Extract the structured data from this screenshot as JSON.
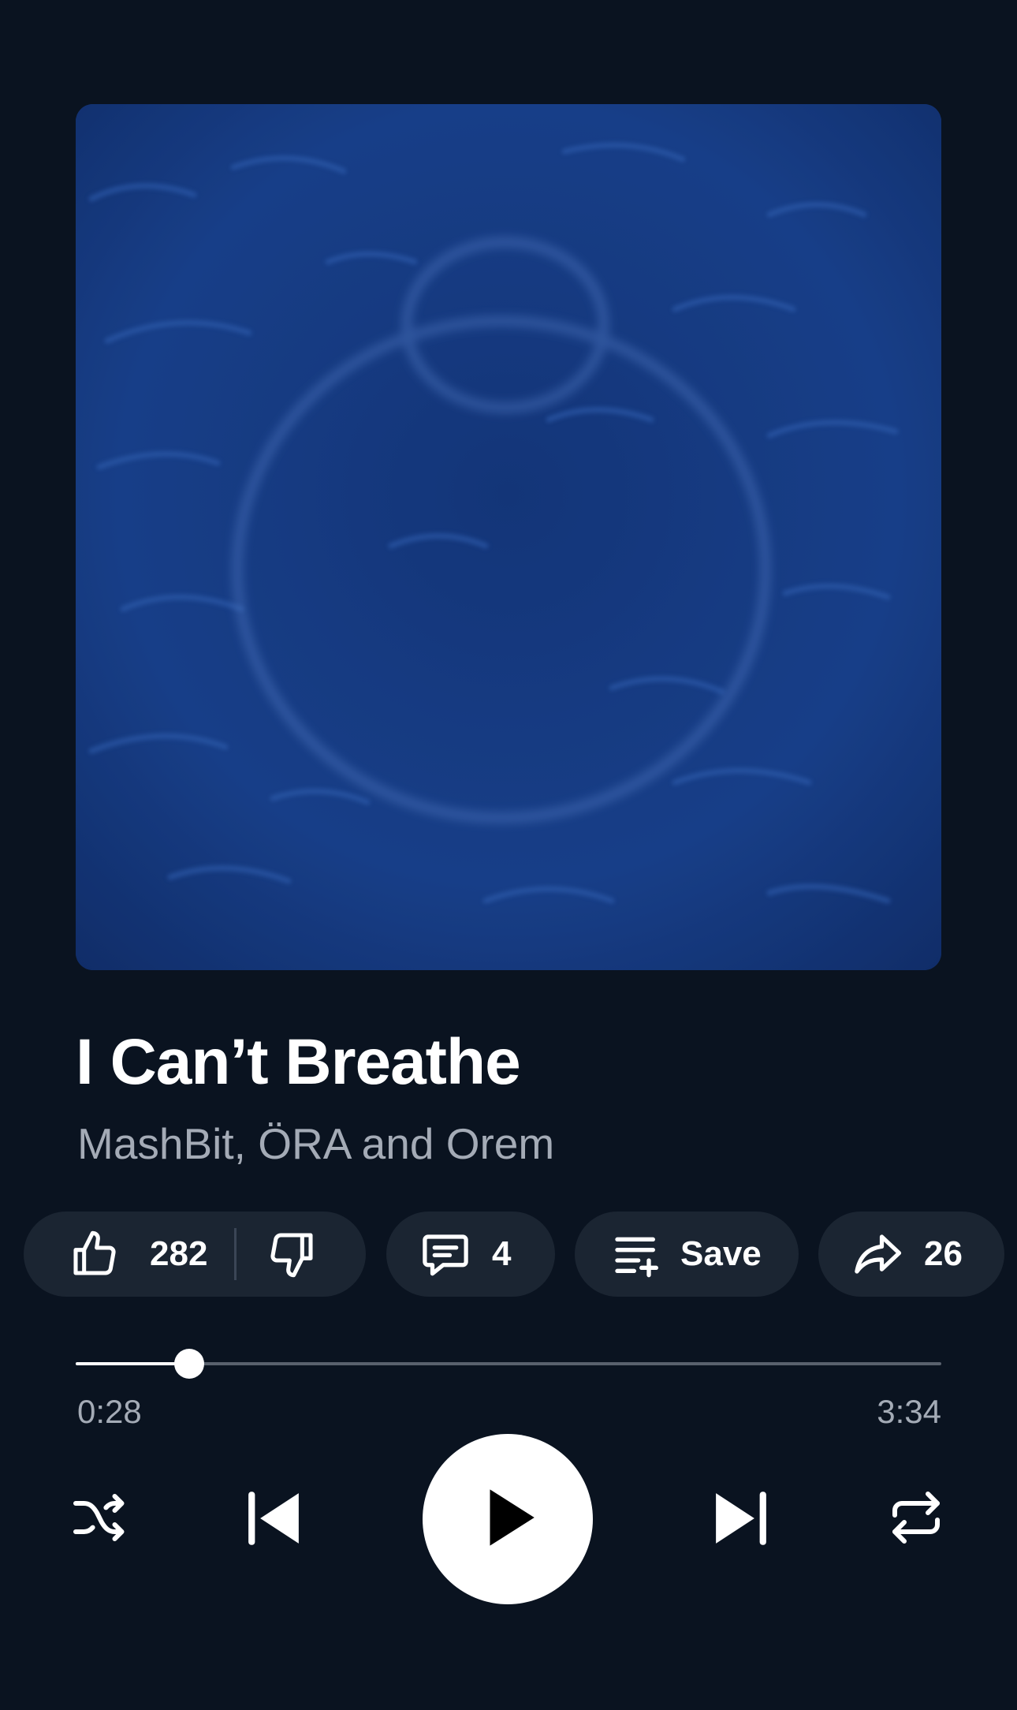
{
  "track": {
    "title": "I Can’t Breathe",
    "artists": "MashBit, ÖRA and Orem",
    "artwork_icon": "album-artwork"
  },
  "actions": {
    "like_count": "282",
    "comment_count": "4",
    "save_label": "Save",
    "share_count": "26",
    "icons": [
      "thumbs-up-icon",
      "thumbs-down-icon",
      "comment-icon",
      "playlist-add-icon",
      "share-icon"
    ]
  },
  "progress": {
    "current_time": "0:28",
    "total_time": "3:34",
    "played_fraction": 0.131
  },
  "controls": {
    "icons": [
      "shuffle-icon",
      "previous-icon",
      "play-icon",
      "next-icon",
      "repeat-icon"
    ]
  },
  "colors": {
    "background": "#0a1320",
    "pill": "#1b2532",
    "secondary_text": "#a4abb6",
    "artwork_blue": "#1a3f86"
  }
}
